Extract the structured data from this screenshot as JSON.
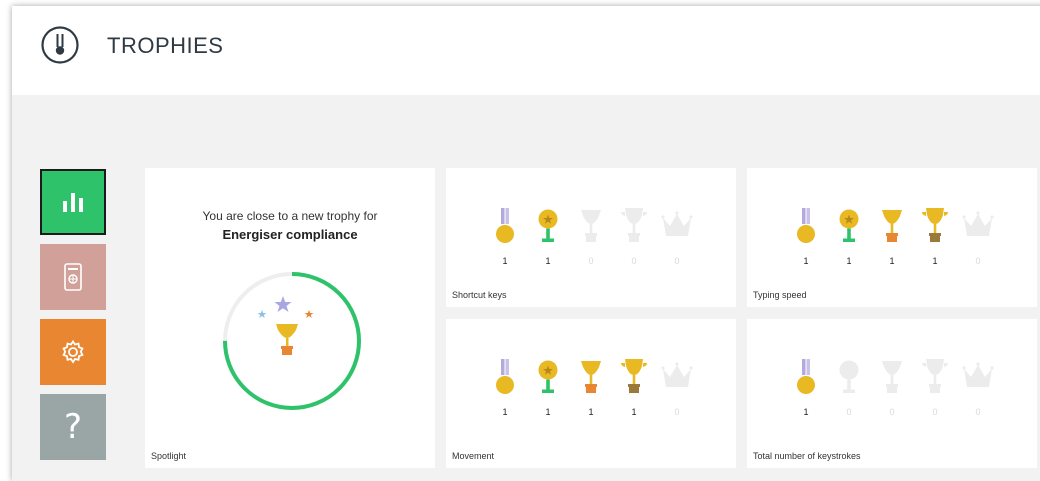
{
  "app": {
    "title": "TROPHIES",
    "logo_icon": "trophy-logo-icon"
  },
  "sidebar": {
    "items": [
      {
        "name": "statistics",
        "icon": "bar-chart-icon",
        "color": "#2ec36a",
        "selected": true
      },
      {
        "name": "dashboard",
        "icon": "device-icon",
        "color": "#d1a199"
      },
      {
        "name": "settings",
        "icon": "gear-icon",
        "color": "#e98631"
      },
      {
        "name": "help",
        "icon": "question-icon",
        "label": "?",
        "color": "#9aa6a6"
      }
    ]
  },
  "spotlight": {
    "line1": "You are close to a new trophy for",
    "line2": "Energiser compliance",
    "label": "Spotlight",
    "progress": 0.75
  },
  "cards": [
    {
      "id": "shortcut",
      "label": "Shortcut keys",
      "counts": [
        "1",
        "1",
        "0",
        "0",
        "0"
      ],
      "achieved": [
        true,
        true,
        false,
        false,
        false
      ]
    },
    {
      "id": "typing",
      "label": "Typing speed",
      "counts": [
        "1",
        "1",
        "1",
        "1",
        "0"
      ],
      "achieved": [
        true,
        true,
        true,
        true,
        false
      ]
    },
    {
      "id": "movement",
      "label": "Movement",
      "counts": [
        "1",
        "1",
        "1",
        "1",
        "0"
      ],
      "achieved": [
        true,
        true,
        true,
        true,
        false
      ]
    },
    {
      "id": "keys",
      "label": "Total number of keystrokes",
      "counts": [
        "1",
        "0",
        "0",
        "0",
        "0"
      ],
      "achieved": [
        true,
        false,
        false,
        false,
        false
      ]
    }
  ],
  "trophy_types": [
    "medal-icon",
    "star-medal-icon",
    "cup-icon",
    "large-cup-icon",
    "crown-icon"
  ],
  "colors": {
    "gold": "#e8b923",
    "green": "#2ec36a",
    "orange": "#e98631",
    "dim": "#ececec"
  }
}
